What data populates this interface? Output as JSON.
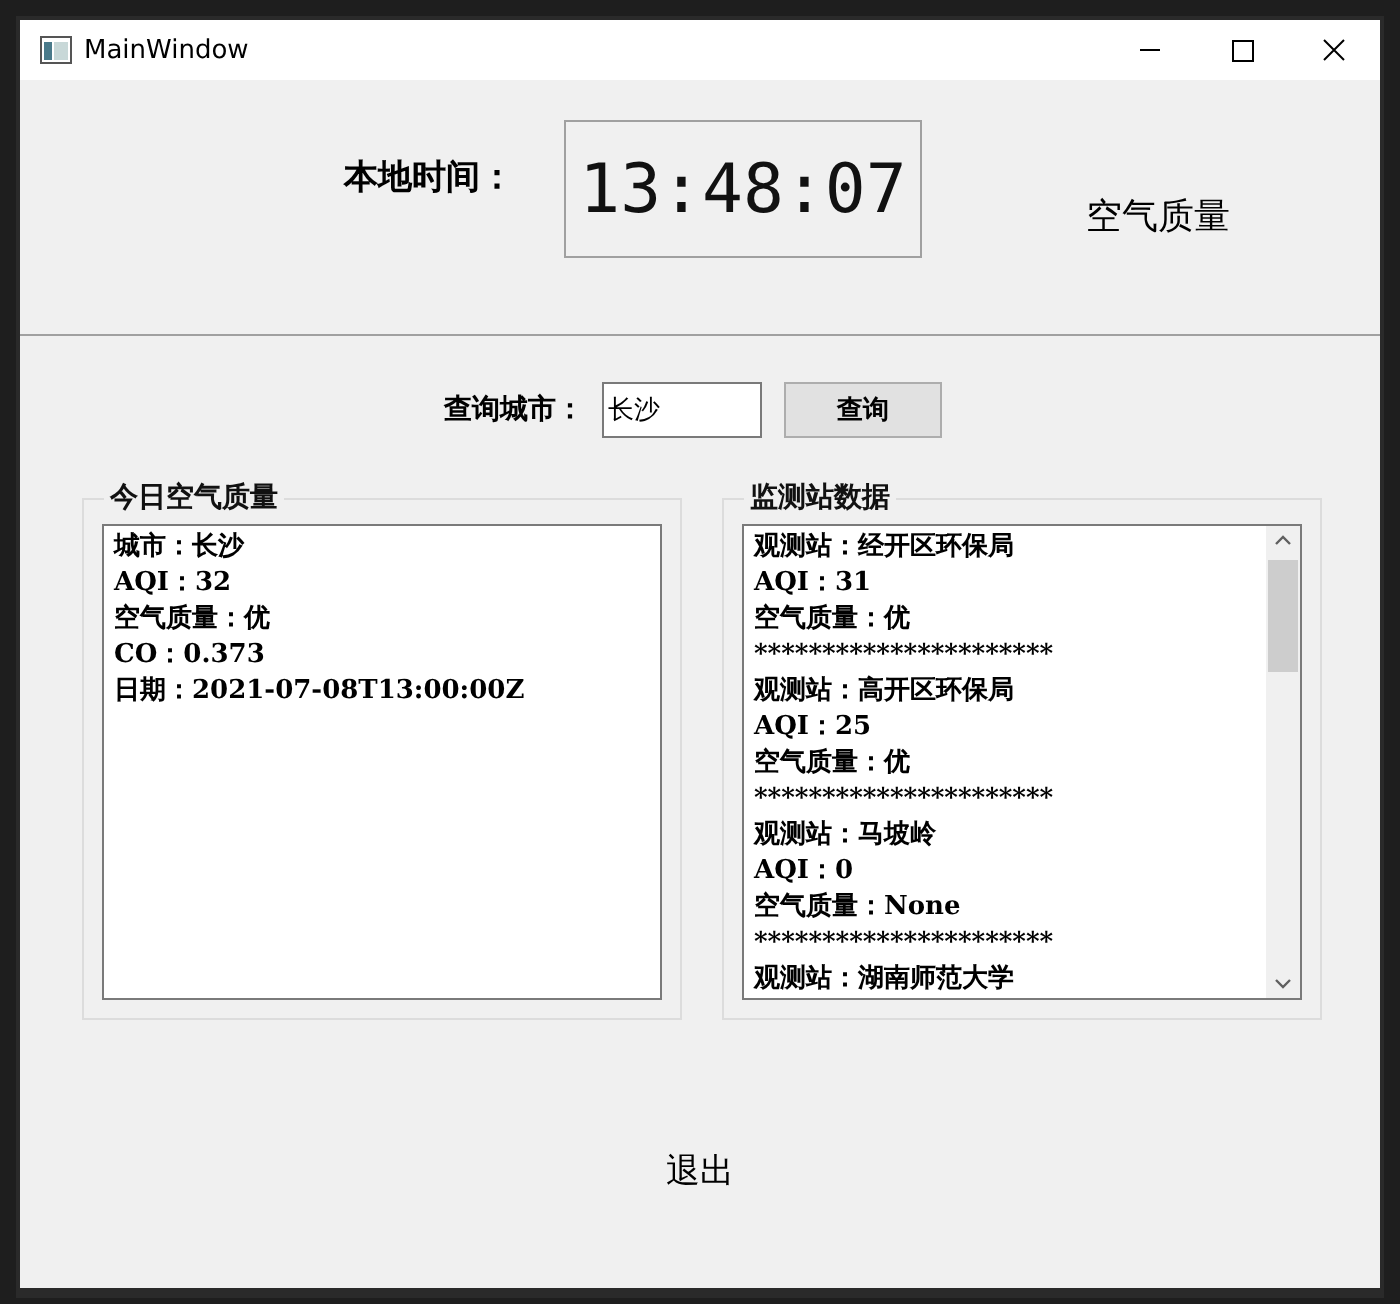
{
  "window": {
    "title": "MainWindow"
  },
  "clock": {
    "label": "本地时间：",
    "time": "13:48:07"
  },
  "heading": "空气质量",
  "query": {
    "label": "查询城市：",
    "value": "长沙",
    "button": "查询"
  },
  "groups": [
    {
      "title": "今日空气质量",
      "scrollbar": false,
      "lines": [
        "城市：长沙",
        "AQI：32",
        "空气质量：优",
        "CO：0.373",
        "日期：2021-07-08T13:00:00Z"
      ]
    },
    {
      "title": "监测站数据",
      "scrollbar": true,
      "lines": [
        "观测站：经开区环保局",
        "AQI：31",
        "空气质量：优",
        "**********************",
        "观测站：高开区环保局",
        "AQI：25",
        "空气质量：优",
        "**********************",
        "观测站：马坡岭",
        "AQI：0",
        "空气质量：None",
        "**********************",
        "观测站：湖南师范大学"
      ]
    }
  ],
  "exit_button": "退出"
}
